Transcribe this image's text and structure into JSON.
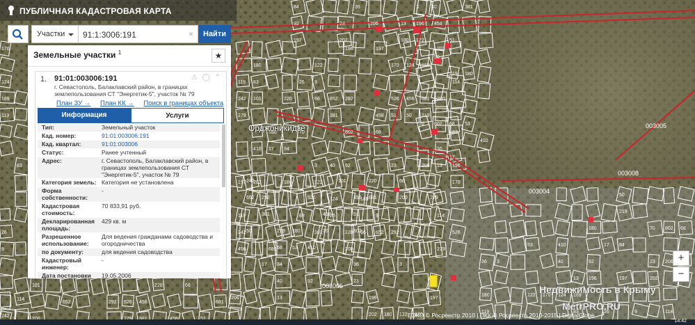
{
  "app": {
    "title": "ПУБЛИЧНАЯ КАДАСТРОВАЯ КАРТА"
  },
  "search": {
    "type_label": "Участки",
    "query": "91:1:3006:191",
    "clear_glyph": "×",
    "submit_label": "Найти"
  },
  "panel": {
    "heading": "Земельные участки",
    "heading_count": "1",
    "star_glyph": "★"
  },
  "card": {
    "index": "1.",
    "cadastral_id": "91:01:003006:191",
    "address": "г. Севастополь, Балаклавский район, в границах землепользования СТ \"Энергетик-5\", участок № 79",
    "icons": "⚠ ◯ ⌃",
    "links": [
      "План ЗУ →",
      "План КК →",
      "Поиск в границах объекта →"
    ],
    "tabs": [
      "Информация",
      "Услуги"
    ],
    "rows": [
      {
        "k": "Тип:",
        "v": "Земельный участок"
      },
      {
        "k": "Кад. номер:",
        "v": "91:01:003006:191",
        "link": true
      },
      {
        "k": "Кад. квартал:",
        "v": "91:01:003006",
        "link": true
      },
      {
        "k": "Статус:",
        "v": "Ранее учтенный"
      },
      {
        "k": "Адрес:",
        "v": "г. Севастополь, Балаклавский район, в границах землепользования СТ \"Энергетик-5\", участок № 79"
      },
      {
        "k": "Категория земель:",
        "v": "Категория не установлена"
      },
      {
        "k": "Форма собственности:",
        "v": "-"
      },
      {
        "k": "Кадастровая стоимость:",
        "v": "70 833,91 руб."
      },
      {
        "k": "Декларированная площадь:",
        "v": "429 кв. м"
      },
      {
        "k": "Разрешенное использование:",
        "v": "Для ведения гражданами садоводства и огородничества"
      },
      {
        "k": "по документу:",
        "v": "для ведения садоводства"
      },
      {
        "k": "Кадастровый инженер:",
        "v": "-"
      },
      {
        "k": "Дата постановки",
        "v": "19.05.2006"
      }
    ]
  },
  "map": {
    "place_name": "Орджоникидзе",
    "quarter_labels": [
      "003005",
      "003008",
      "003004",
      "003006"
    ],
    "parcel_numbers": [
      "196",
      "197",
      "202",
      "180",
      "122",
      "170",
      "124",
      "189",
      "119",
      "83",
      "26",
      "9",
      "114",
      "242",
      "101",
      "220",
      "66",
      "652",
      "292",
      "526",
      "456",
      "681",
      "200",
      "279",
      "381",
      "458",
      "51",
      "50",
      "219",
      "180",
      "70",
      "802",
      "68",
      "53",
      "410",
      "17",
      "84",
      "36",
      "3",
      "40",
      "92",
      "23",
      "206",
      "13"
    ]
  },
  "attribution": "ЕЭКО © Росреестр 2010 | ПКК © Росреестр 2010-2015 | DigitalGlobe",
  "watermark": {
    "line1": "Недвижимость в Крыму",
    "line2": "MetrPRO.RU"
  },
  "zoom": {
    "in": "+",
    "out": "−"
  },
  "taskbar": {
    "clock": "14:42"
  },
  "colors": {
    "accent": "#1f5fa9",
    "parcel_line": "#ffffff",
    "boundary": "#c8262b",
    "building": "#e0303c"
  }
}
